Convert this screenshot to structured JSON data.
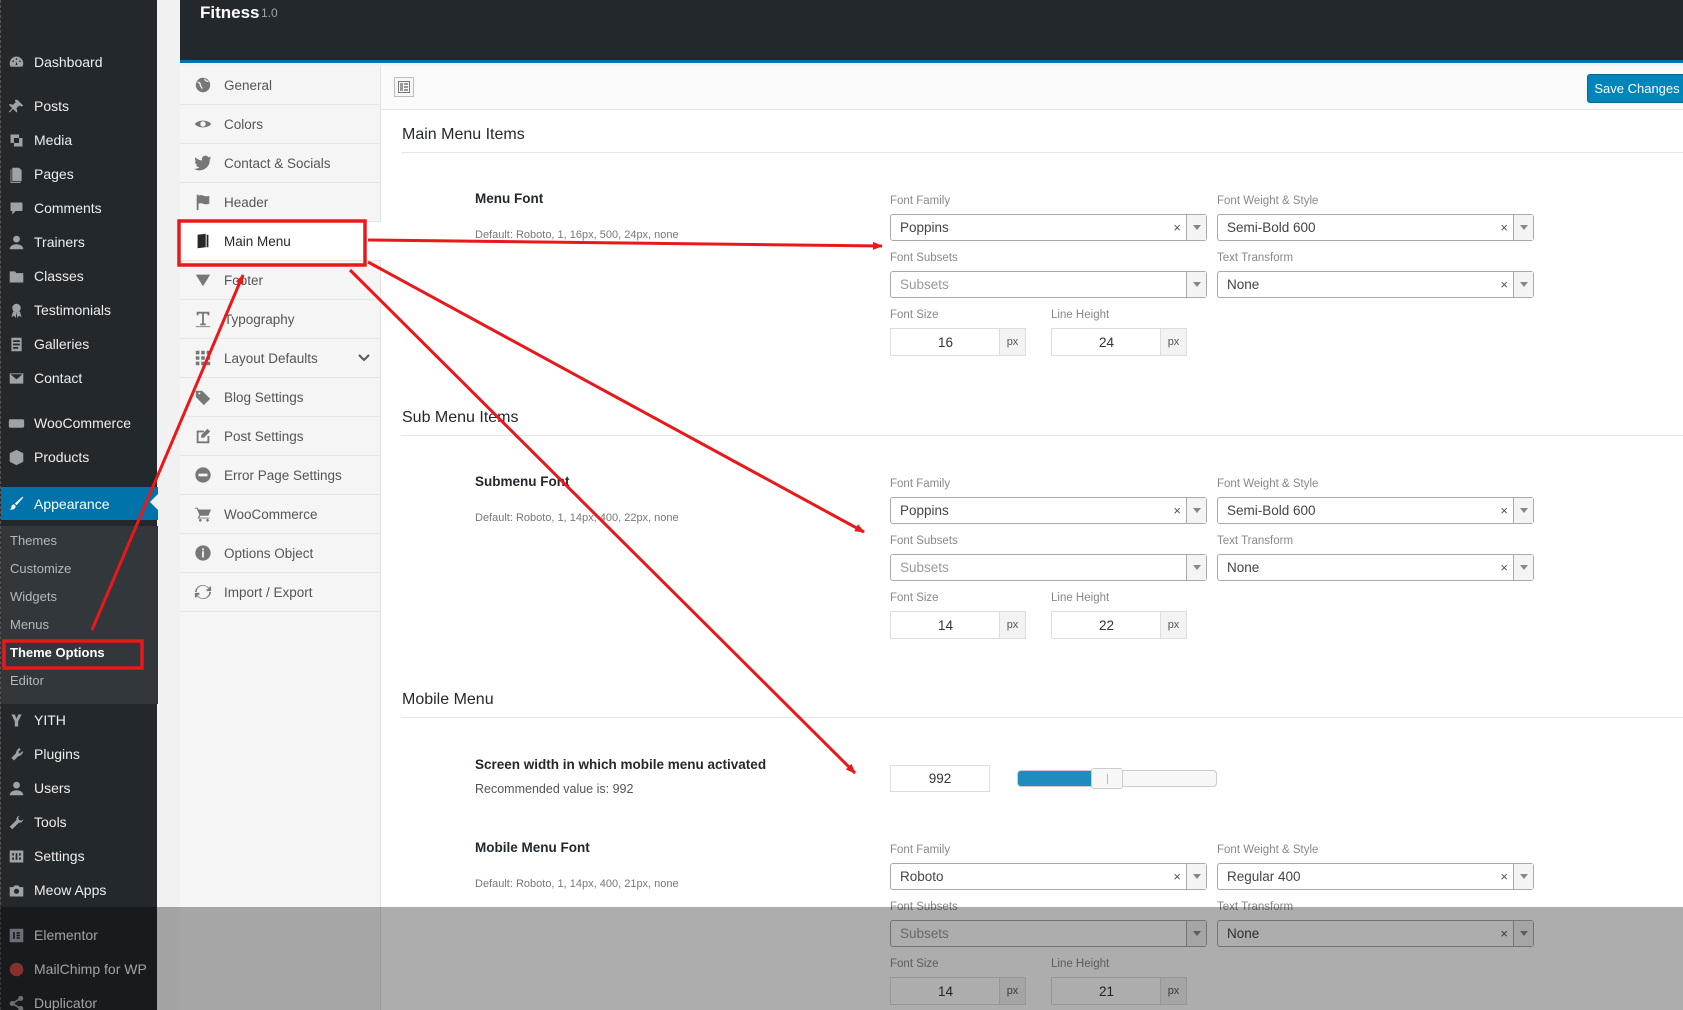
{
  "wp_menu": {
    "items": [
      {
        "label": "Dashboard",
        "icon": "dashboard-icon"
      },
      {
        "label": "Posts",
        "icon": "pin-icon"
      },
      {
        "label": "Media",
        "icon": "media-icon"
      },
      {
        "label": "Pages",
        "icon": "pages-icon"
      },
      {
        "label": "Comments",
        "icon": "comment-icon"
      },
      {
        "label": "Trainers",
        "icon": "user-icon"
      },
      {
        "label": "Classes",
        "icon": "folder-icon"
      },
      {
        "label": "Testimonials",
        "icon": "award-icon"
      },
      {
        "label": "Galleries",
        "icon": "document-icon"
      },
      {
        "label": "Contact",
        "icon": "envelope-icon"
      },
      {
        "label": "WooCommerce",
        "icon": "woo-icon"
      },
      {
        "label": "Products",
        "icon": "box-icon"
      },
      {
        "label": "Appearance",
        "icon": "brush-icon"
      },
      {
        "label": "YITH",
        "icon": "yith-icon"
      },
      {
        "label": "Plugins",
        "icon": "plug-icon"
      },
      {
        "label": "Users",
        "icon": "users-icon"
      },
      {
        "label": "Tools",
        "icon": "wrench-icon"
      },
      {
        "label": "Settings",
        "icon": "settings-icon"
      },
      {
        "label": "Meow Apps",
        "icon": "camera-icon"
      },
      {
        "label": "Elementor",
        "icon": "elementor-icon"
      },
      {
        "label": "MailChimp for WP",
        "icon": "mailchimp-icon"
      },
      {
        "label": "Duplicator",
        "icon": "share-icon"
      }
    ],
    "appearance_submenu": [
      "Themes",
      "Customize",
      "Widgets",
      "Menus",
      "Theme Options",
      "Editor"
    ]
  },
  "header": {
    "title": "Fitness",
    "version": "1.0"
  },
  "options_nav": [
    {
      "label": "General",
      "icon": "globe-icon"
    },
    {
      "label": "Colors",
      "icon": "eye-icon"
    },
    {
      "label": "Contact & Socials",
      "icon": "twitter-icon"
    },
    {
      "label": "Header",
      "icon": "flag-icon"
    },
    {
      "label": "Main Menu",
      "icon": "book-icon"
    },
    {
      "label": "Footer",
      "icon": "triangle-down-icon"
    },
    {
      "label": "Typography",
      "icon": "text-icon"
    },
    {
      "label": "Layout Defaults",
      "icon": "grid-icon"
    },
    {
      "label": "Blog Settings",
      "icon": "tags-icon"
    },
    {
      "label": "Post Settings",
      "icon": "edit-icon"
    },
    {
      "label": "Error Page Settings",
      "icon": "minus-circle-icon"
    },
    {
      "label": "WooCommerce",
      "icon": "cart-icon"
    },
    {
      "label": "Options Object",
      "icon": "info-icon"
    },
    {
      "label": "Import / Export",
      "icon": "refresh-icon"
    }
  ],
  "toolbar": {
    "save_label": "Save Changes"
  },
  "labels": {
    "font_family": "Font Family",
    "font_weight": "Font Weight & Style",
    "font_subsets": "Font Subsets",
    "text_transform": "Text Transform",
    "font_size": "Font Size",
    "line_height": "Line Height",
    "px": "px"
  },
  "sections": {
    "main_menu": {
      "title": "Main Menu Items",
      "option_label": "Menu Font",
      "default": "Default: Roboto, 1, 16px, 500, 24px, none",
      "font_family": "Poppins",
      "font_weight": "Semi-Bold 600",
      "subsets_placeholder": "Subsets",
      "text_transform": "None",
      "font_size": "16",
      "line_height": "24"
    },
    "sub_menu": {
      "title": "Sub Menu Items",
      "option_label": "Submenu Font",
      "default": "Default: Roboto, 1, 14px, 400, 22px, none",
      "font_family": "Poppins",
      "font_weight": "Semi-Bold 600",
      "subsets_placeholder": "Subsets",
      "text_transform": "None",
      "font_size": "14",
      "line_height": "22"
    },
    "mobile_menu": {
      "title": "Mobile Menu",
      "width_label": "Screen width in which mobile menu activated",
      "width_recommend": "Recommended value is: 992",
      "width_value": "992",
      "slider_fraction": 0.45,
      "option_label": "Mobile Menu Font",
      "default": "Default: Roboto, 1, 14px, 400, 21px, none",
      "font_family": "Roboto",
      "font_weight": "Regular 400",
      "subsets_placeholder": "Subsets",
      "text_transform": "None",
      "font_size": "14",
      "line_height": "21"
    }
  },
  "colors": {
    "accent": "#0073aa",
    "annotation": "#e8181b",
    "admin_dark": "#23282d"
  }
}
